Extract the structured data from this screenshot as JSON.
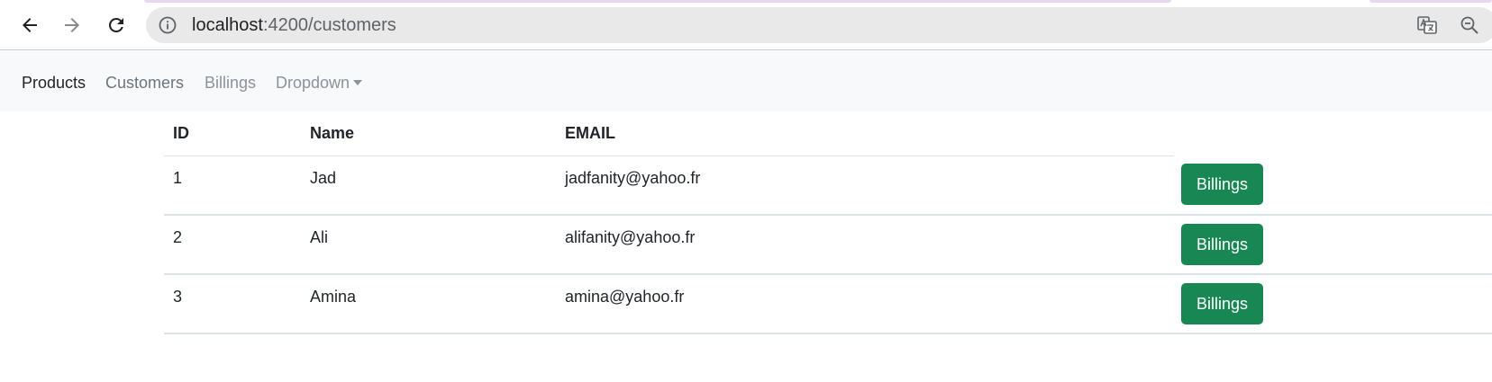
{
  "browser": {
    "url_host": "localhost",
    "url_path": ":4200/customers"
  },
  "navbar": {
    "items": [
      {
        "label": "Products"
      },
      {
        "label": "Customers"
      },
      {
        "label": "Billings"
      },
      {
        "label": "Dropdown"
      }
    ]
  },
  "table": {
    "headers": [
      "ID",
      "Name",
      "EMAIL"
    ],
    "rows": [
      {
        "id": "1",
        "name": "Jad",
        "email": "jadfanity@yahoo.fr",
        "action": "Billings"
      },
      {
        "id": "2",
        "name": "Ali",
        "email": "alifanity@yahoo.fr",
        "action": "Billings"
      },
      {
        "id": "3",
        "name": "Amina",
        "email": "amina@yahoo.fr",
        "action": "Billings"
      }
    ]
  },
  "colors": {
    "button_bg": "#198754",
    "navbar_bg": "#f8f9fa"
  }
}
